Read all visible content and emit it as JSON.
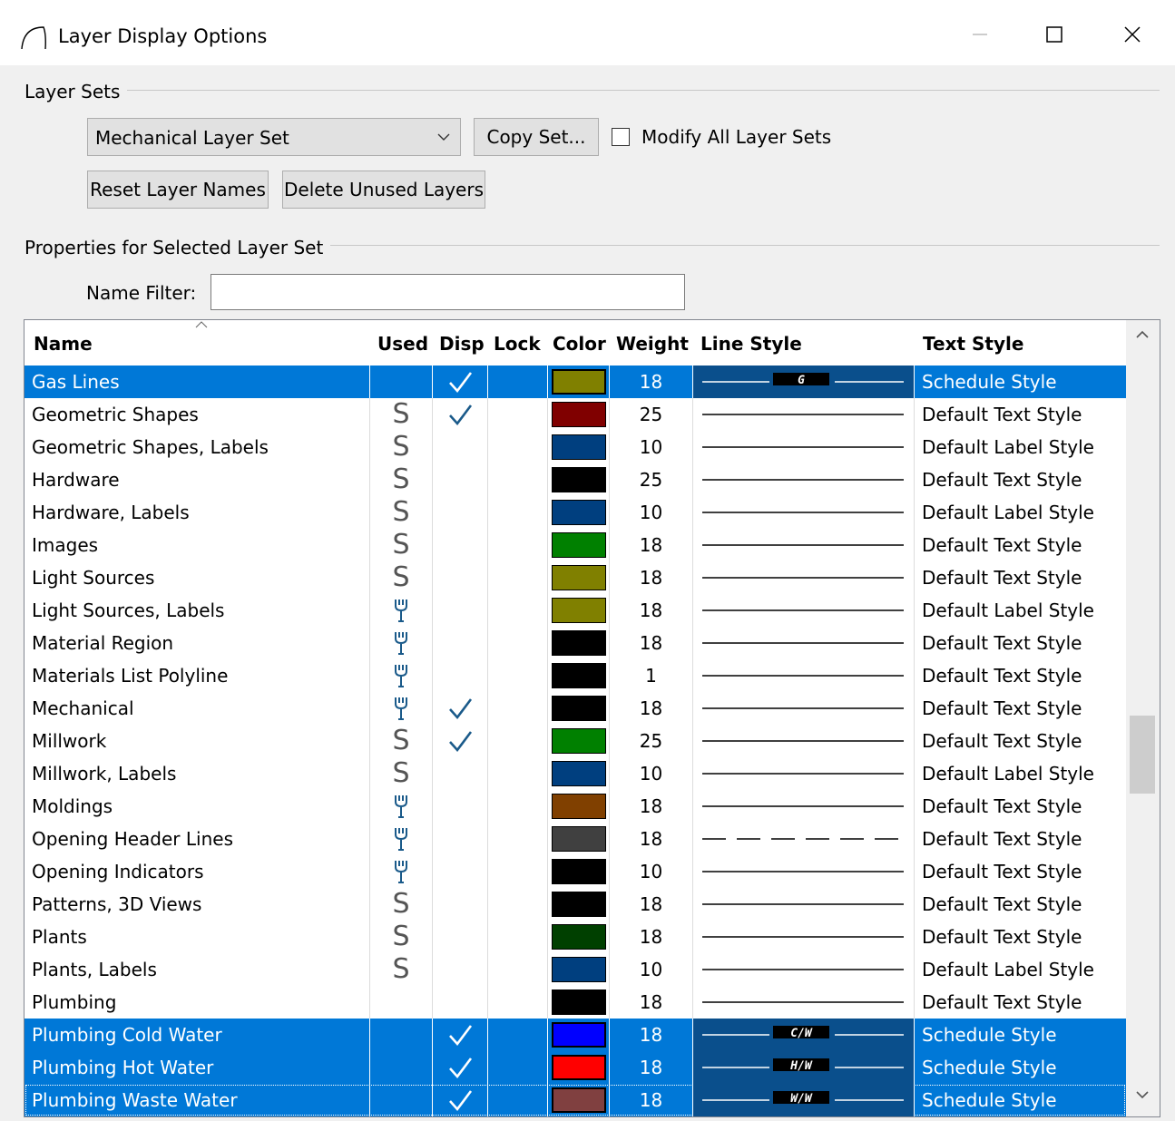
{
  "window": {
    "title": "Layer Display Options"
  },
  "layer_sets": {
    "group_label": "Layer Sets",
    "selected_set": "Mechanical Layer Set",
    "copy_set_label": "Copy Set...",
    "modify_all_label": "Modify All Layer Sets",
    "modify_all_checked": false,
    "reset_names_label": "Reset Layer Names",
    "delete_unused_label": "Delete Unused Layers"
  },
  "properties": {
    "group_label": "Properties for Selected Layer Set",
    "name_filter_label": "Name Filter:",
    "name_filter_value": ""
  },
  "table": {
    "columns": {
      "name": "Name",
      "used": "Used",
      "disp": "Disp",
      "lock": "Lock",
      "color": "Color",
      "weight": "Weight",
      "line_style": "Line Style",
      "text_style": "Text Style"
    },
    "rows": [
      {
        "name": "Gas Lines",
        "used": "",
        "disp": true,
        "color": "#808000",
        "weight": "18",
        "line": "labeled",
        "line_label": "G",
        "text_style": "Schedule Style",
        "selected": true
      },
      {
        "name": "Geometric Shapes",
        "used": "S",
        "disp": true,
        "color": "#800000",
        "weight": "25",
        "line": "solid",
        "line_label": "",
        "text_style": "Default Text Style",
        "selected": false
      },
      {
        "name": "Geometric Shapes, Labels",
        "used": "S",
        "disp": false,
        "color": "#003f7f",
        "weight": "10",
        "line": "solid",
        "line_label": "",
        "text_style": "Default Label Style",
        "selected": false
      },
      {
        "name": "Hardware",
        "used": "S",
        "disp": false,
        "color": "#000000",
        "weight": "25",
        "line": "solid",
        "line_label": "",
        "text_style": "Default Text Style",
        "selected": false
      },
      {
        "name": "Hardware, Labels",
        "used": "S",
        "disp": false,
        "color": "#003f7f",
        "weight": "10",
        "line": "solid",
        "line_label": "",
        "text_style": "Default Label Style",
        "selected": false
      },
      {
        "name": "Images",
        "used": "S",
        "disp": false,
        "color": "#008000",
        "weight": "18",
        "line": "solid",
        "line_label": "",
        "text_style": "Default Text Style",
        "selected": false
      },
      {
        "name": "Light Sources",
        "used": "S",
        "disp": false,
        "color": "#808000",
        "weight": "18",
        "line": "solid",
        "line_label": "",
        "text_style": "Default Text Style",
        "selected": false
      },
      {
        "name": "Light Sources, Labels",
        "used": "wrench",
        "disp": false,
        "color": "#808000",
        "weight": "18",
        "line": "solid",
        "line_label": "",
        "text_style": "Default Label Style",
        "selected": false
      },
      {
        "name": "Material Region",
        "used": "wrench",
        "disp": false,
        "color": "#000000",
        "weight": "18",
        "line": "solid",
        "line_label": "",
        "text_style": "Default Text Style",
        "selected": false
      },
      {
        "name": "Materials List Polyline",
        "used": "wrench",
        "disp": false,
        "color": "#000000",
        "weight": "1",
        "line": "solid",
        "line_label": "",
        "text_style": "Default Text Style",
        "selected": false
      },
      {
        "name": "Mechanical",
        "used": "wrench",
        "disp": true,
        "color": "#000000",
        "weight": "18",
        "line": "solid",
        "line_label": "",
        "text_style": "Default Text Style",
        "selected": false
      },
      {
        "name": "Millwork",
        "used": "S",
        "disp": true,
        "color": "#008000",
        "weight": "25",
        "line": "solid",
        "line_label": "",
        "text_style": "Default Text Style",
        "selected": false
      },
      {
        "name": "Millwork, Labels",
        "used": "S",
        "disp": false,
        "color": "#003f7f",
        "weight": "10",
        "line": "solid",
        "line_label": "",
        "text_style": "Default Label Style",
        "selected": false
      },
      {
        "name": "Moldings",
        "used": "wrench",
        "disp": false,
        "color": "#804000",
        "weight": "18",
        "line": "solid",
        "line_label": "",
        "text_style": "Default Text Style",
        "selected": false
      },
      {
        "name": "Opening Header Lines",
        "used": "wrench",
        "disp": false,
        "color": "#404040",
        "weight": "18",
        "line": "dashed",
        "line_label": "",
        "text_style": "Default Text Style",
        "selected": false
      },
      {
        "name": "Opening Indicators",
        "used": "wrench",
        "disp": false,
        "color": "#000000",
        "weight": "10",
        "line": "solid",
        "line_label": "",
        "text_style": "Default Text Style",
        "selected": false
      },
      {
        "name": "Patterns, 3D Views",
        "used": "S",
        "disp": false,
        "color": "#000000",
        "weight": "18",
        "line": "solid",
        "line_label": "",
        "text_style": "Default Text Style",
        "selected": false
      },
      {
        "name": "Plants",
        "used": "S",
        "disp": false,
        "color": "#004000",
        "weight": "18",
        "line": "solid",
        "line_label": "",
        "text_style": "Default Text Style",
        "selected": false
      },
      {
        "name": "Plants, Labels",
        "used": "S",
        "disp": false,
        "color": "#003f7f",
        "weight": "10",
        "line": "solid",
        "line_label": "",
        "text_style": "Default Label Style",
        "selected": false
      },
      {
        "name": "Plumbing",
        "used": "",
        "disp": false,
        "color": "#000000",
        "weight": "18",
        "line": "solid",
        "line_label": "",
        "text_style": "Default Text Style",
        "selected": false
      },
      {
        "name": "Plumbing Cold Water",
        "used": "",
        "disp": true,
        "color": "#0000ff",
        "weight": "18",
        "line": "labeled",
        "line_label": "C/W",
        "text_style": "Schedule Style",
        "selected": true
      },
      {
        "name": "Plumbing Hot Water",
        "used": "",
        "disp": true,
        "color": "#ff0000",
        "weight": "18",
        "line": "labeled",
        "line_label": "H/W",
        "text_style": "Schedule Style",
        "selected": true
      },
      {
        "name": "Plumbing Waste Water",
        "used": "",
        "disp": true,
        "color": "#804040",
        "weight": "18",
        "line": "labeled",
        "line_label": "W/W",
        "text_style": "Schedule Style",
        "selected": true
      }
    ]
  }
}
